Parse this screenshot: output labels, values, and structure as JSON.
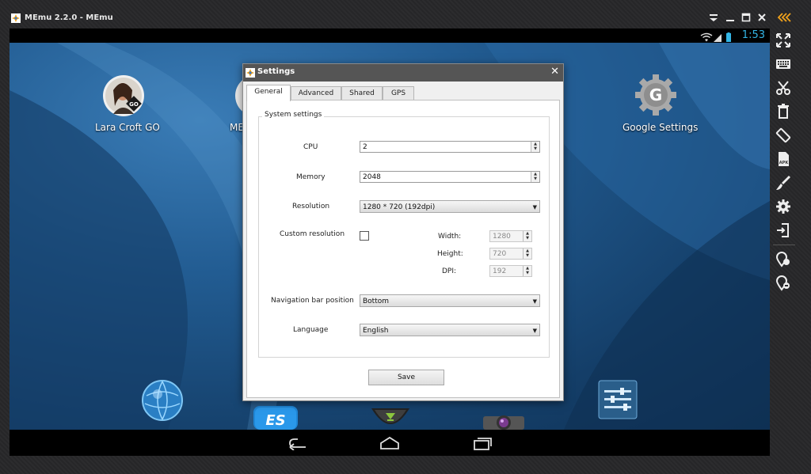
{
  "window": {
    "title": "MEmu 2.2.0 - MEmu",
    "accent": "#f2a31b"
  },
  "android": {
    "status_time": "1:53",
    "desktop_icons": [
      {
        "label": "Lara Croft GO"
      },
      {
        "label": "ME"
      },
      {
        "label": "Google Settings"
      }
    ]
  },
  "sidebar": {
    "buttons": [
      "fullscreen-icon",
      "keyboard-icon",
      "scissors-icon",
      "trash-icon",
      "rotate-icon",
      "apk-icon",
      "brush-icon",
      "gear-icon",
      "import-icon",
      "location-icon-1",
      "location-icon-2"
    ]
  },
  "dialog": {
    "title": "Settings",
    "tabs": [
      "General",
      "Advanced",
      "Shared",
      "GPS"
    ],
    "active_tab": "General",
    "group_title": "System settings",
    "cpu": {
      "label": "CPU",
      "value": "2"
    },
    "memory": {
      "label": "Memory",
      "value": "2048"
    },
    "resolution": {
      "label": "Resolution",
      "value": "1280 * 720 (192dpi)"
    },
    "custom_resolution": {
      "label": "Custom resolution",
      "checked": false,
      "width_label": "Width:",
      "width": "1280",
      "height_label": "Height:",
      "height": "720",
      "dpi_label": "DPI:",
      "dpi": "192"
    },
    "nav_bar": {
      "label": "Navigation bar position",
      "value": "Bottom"
    },
    "language": {
      "label": "Language",
      "value": "English"
    },
    "save_label": "Save"
  }
}
